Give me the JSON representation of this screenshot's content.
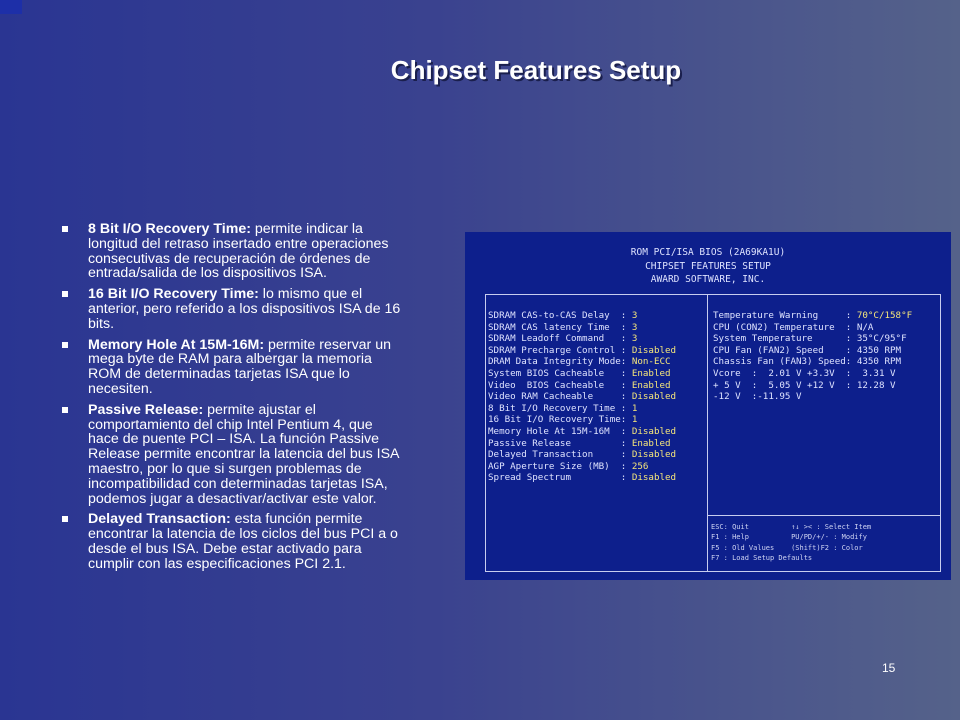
{
  "slide": {
    "title": "Chipset Features Setup",
    "page_number": "15"
  },
  "bullets": [
    {
      "term": "8 Bit I/O Recovery Time:",
      "text": " permite indicar la longitud del retraso insertado entre operaciones consecutivas de recuperación de órdenes de entrada/salida de los dispositivos ISA."
    },
    {
      "term": "16 Bit I/O Recovery Time:",
      "text": " lo mismo que el anterior, pero referido a los dispositivos ISA de 16 bits."
    },
    {
      "term": "Memory Hole At 15M-16M:",
      "text": " permite reservar un mega byte de RAM para albergar la memoria ROM de determinadas tarjetas ISA que lo necesiten."
    },
    {
      "term": "Passive Release:",
      "text": " permite ajustar el comportamiento del chip Intel Pentium 4, que hace de puente PCI – ISA. La función Passive Release permite encontrar la latencia del bus ISA maestro, por lo que si surgen problemas de incompatibilidad con determinadas tarjetas ISA, podemos jugar a desactivar/activar este valor."
    },
    {
      "term": "Delayed Transaction:",
      "text": " esta función permite encontrar la latencia de los ciclos del bus PCI a o desde el bus ISA. Debe estar activado para cumplir con las especificaciones PCI 2.1."
    }
  ],
  "bios": {
    "header": [
      "ROM PCI/ISA BIOS (2A69KA1U)",
      "CHIPSET FEATURES SETUP",
      "AWARD SOFTWARE, INC."
    ],
    "settings": [
      {
        "label": "SDRAM CAS-to-CAS Delay  : ",
        "value": "3"
      },
      {
        "label": "SDRAM CAS latency Time  : ",
        "value": "3"
      },
      {
        "label": "SDRAM Leadoff Command   : ",
        "value": "3"
      },
      {
        "label": "SDRAM Precharge Control : ",
        "value": "Disabled"
      },
      {
        "label": "DRAM Data Integrity Mode: ",
        "value": "Non-ECC"
      },
      {
        "label": "System BIOS Cacheable   : ",
        "value": "Enabled"
      },
      {
        "label": "Video  BIOS Cacheable   : ",
        "value": "Enabled"
      },
      {
        "label": "Video RAM Cacheable     : ",
        "value": "Disabled"
      },
      {
        "label": "8 Bit I/O Recovery Time : ",
        "value": "1"
      },
      {
        "label": "16 Bit I/O Recovery Time: ",
        "value": "1"
      },
      {
        "label": "Memory Hole At 15M-16M  : ",
        "value": "Disabled"
      },
      {
        "label": "Passive Release         : ",
        "value": "Enabled"
      },
      {
        "label": "Delayed Transaction     : ",
        "value": "Disabled"
      },
      {
        "label": "AGP Aperture Size (MB)  : ",
        "value": "256"
      },
      {
        "label": "Spread Spectrum         : ",
        "value": "Disabled"
      }
    ],
    "monitor": [
      {
        "label": "Temperature Warning     : ",
        "value": "70°C/158°F"
      },
      {
        "label": "CPU (CON2) Temperature  : ",
        "value": "N/A"
      },
      {
        "label": "System Temperature      : ",
        "value": "35°C/95°F"
      },
      {
        "label": "CPU Fan (FAN2) Speed    : ",
        "value": "4350 RPM"
      },
      {
        "label": "Chassis Fan (FAN3) Speed: ",
        "value": "4350 RPM"
      },
      {
        "label": "Vcore  :  2.01 V +3.3V  :  3.31 V",
        "value": ""
      },
      {
        "label": "+ 5 V  :  5.05 V +12 V  : 12.28 V",
        "value": ""
      },
      {
        "label": "-12 V  :-11.95 V",
        "value": ""
      }
    ],
    "help": [
      "ESC: Quit          ↑↓ >< : Select Item",
      "F1 : Help          PU/PD/+/- : Modify",
      "F5 : Old Values    (Shift)F2 : Color",
      "F7 : Load Setup Defaults"
    ]
  }
}
